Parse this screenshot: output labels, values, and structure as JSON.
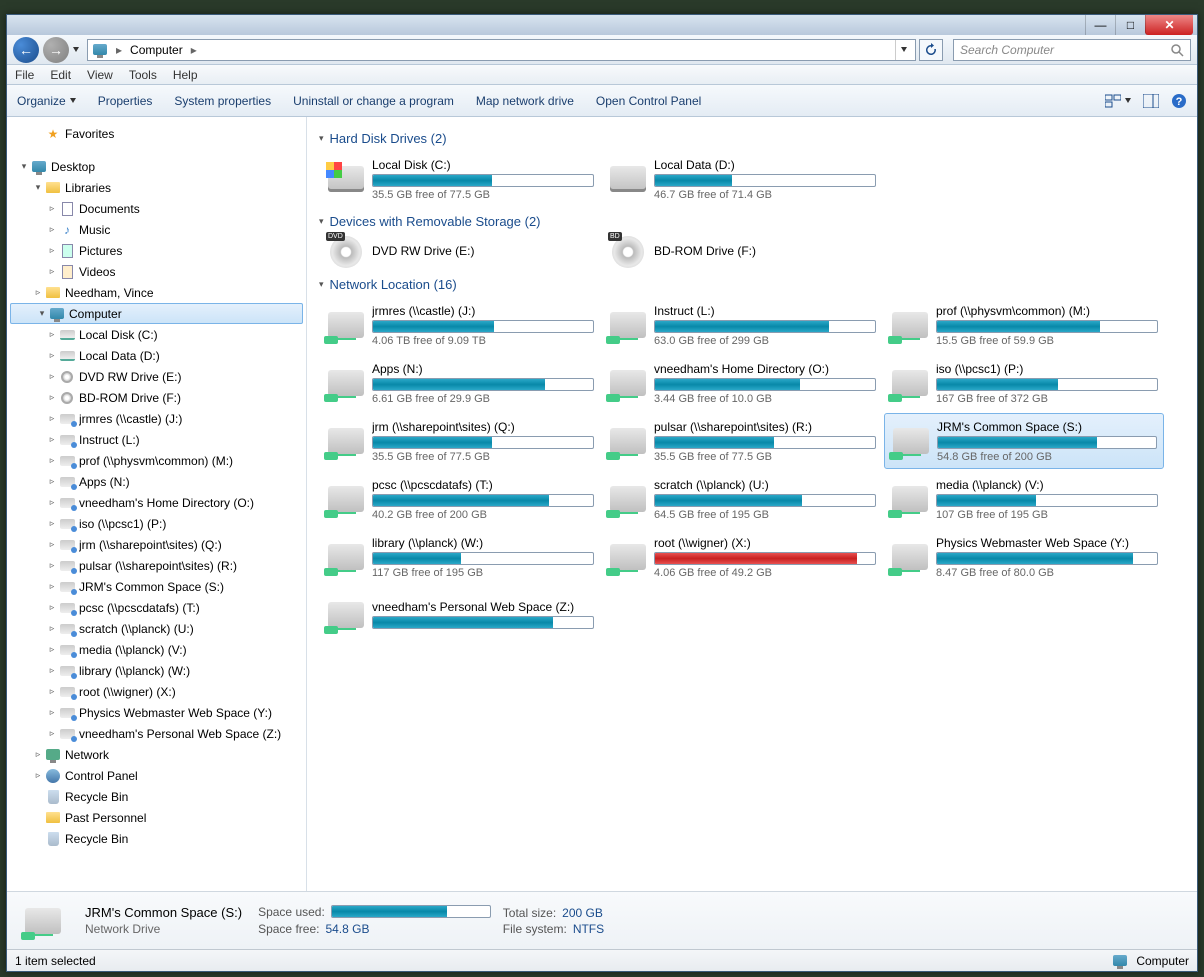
{
  "titlebar": {
    "min": "—",
    "max": "□",
    "close": "✕"
  },
  "nav": {
    "back": "←",
    "fwd": "→"
  },
  "breadcrumb": {
    "root_icon": "computer",
    "seg1": "Computer"
  },
  "search": {
    "placeholder": "Search Computer"
  },
  "menu": {
    "file": "File",
    "edit": "Edit",
    "view": "View",
    "tools": "Tools",
    "help": "Help"
  },
  "toolbar": {
    "organize": "Organize",
    "properties": "Properties",
    "sysprops": "System properties",
    "uninstall": "Uninstall or change a program",
    "mapnet": "Map network drive",
    "cpl": "Open Control Panel"
  },
  "tree": {
    "favorites": "Favorites",
    "desktop": "Desktop",
    "libraries": "Libraries",
    "documents": "Documents",
    "music": "Music",
    "pictures": "Pictures",
    "videos": "Videos",
    "user": "Needham, Vince",
    "computer": "Computer",
    "network": "Network",
    "cpl": "Control Panel",
    "recycle": "Recycle Bin",
    "past": "Past Personnel",
    "recycle2": "Recycle Bin",
    "drives": {
      "c": "Local Disk (C:)",
      "d": "Local Data (D:)",
      "e": "DVD RW Drive (E:)",
      "f": "BD-ROM Drive (F:)",
      "j": "jrmres (\\\\castle) (J:)",
      "l": "Instruct (L:)",
      "m": "prof (\\\\physvm\\common) (M:)",
      "n": "Apps (N:)",
      "o": "vneedham's  Home Directory (O:)",
      "p": "iso (\\\\pcsc1) (P:)",
      "q": "jrm (\\\\sharepoint\\sites) (Q:)",
      "r": "pulsar (\\\\sharepoint\\sites) (R:)",
      "s": "JRM's Common Space (S:)",
      "t": "pcsc (\\\\pcscdatafs) (T:)",
      "u": "scratch (\\\\planck) (U:)",
      "v": "media (\\\\planck) (V:)",
      "w": "library (\\\\planck) (W:)",
      "x": "root (\\\\wigner) (X:)",
      "y": "Physics Webmaster Web Space (Y:)",
      "z": "vneedham's  Personal Web Space (Z:)"
    }
  },
  "sections": {
    "hdd": "Hard Disk Drives (2)",
    "removable": "Devices with Removable Storage (2)",
    "network": "Network Location (16)"
  },
  "drives": {
    "c": {
      "name": "Local Disk (C:)",
      "free": "35.5 GB free of 77.5 GB",
      "pct": 54,
      "type": "win"
    },
    "d": {
      "name": "Local Data (D:)",
      "free": "46.7 GB free of 71.4 GB",
      "pct": 35,
      "type": "hdd"
    },
    "e": {
      "name": "DVD RW Drive (E:)",
      "badge": "DVD"
    },
    "f": {
      "name": "BD-ROM Drive (F:)",
      "badge": "BD"
    },
    "j": {
      "name": "jrmres (\\\\castle) (J:)",
      "free": "4.06 TB free of 9.09 TB",
      "pct": 55
    },
    "l": {
      "name": "Instruct (L:)",
      "free": "63.0 GB free of 299 GB",
      "pct": 79
    },
    "m": {
      "name": "prof (\\\\physvm\\common) (M:)",
      "free": "15.5 GB free of 59.9 GB",
      "pct": 74
    },
    "n": {
      "name": "Apps (N:)",
      "free": "6.61 GB free of 29.9 GB",
      "pct": 78
    },
    "o": {
      "name": "vneedham's  Home Directory (O:)",
      "free": "3.44 GB free of 10.0 GB",
      "pct": 66
    },
    "p": {
      "name": "iso (\\\\pcsc1) (P:)",
      "free": "167 GB free of 372 GB",
      "pct": 55
    },
    "q": {
      "name": "jrm (\\\\sharepoint\\sites) (Q:)",
      "free": "35.5 GB free of 77.5 GB",
      "pct": 54
    },
    "r": {
      "name": "pulsar (\\\\sharepoint\\sites) (R:)",
      "free": "35.5 GB free of 77.5 GB",
      "pct": 54
    },
    "s": {
      "name": "JRM's Common Space (S:)",
      "free": "54.8 GB free of 200 GB",
      "pct": 73
    },
    "t": {
      "name": "pcsc (\\\\pcscdatafs) (T:)",
      "free": "40.2 GB free of 200 GB",
      "pct": 80
    },
    "u": {
      "name": "scratch (\\\\planck) (U:)",
      "free": "64.5 GB free of 195 GB",
      "pct": 67
    },
    "v": {
      "name": "media (\\\\planck) (V:)",
      "free": "107 GB free of 195 GB",
      "pct": 45
    },
    "w": {
      "name": "library (\\\\planck) (W:)",
      "free": "117 GB free of 195 GB",
      "pct": 40
    },
    "x": {
      "name": "root (\\\\wigner) (X:)",
      "free": "4.06 GB free of 49.2 GB",
      "pct": 92,
      "red": true
    },
    "y": {
      "name": "Physics Webmaster Web Space (Y:)",
      "free": "8.47 GB free of 80.0 GB",
      "pct": 89
    },
    "z": {
      "name": "vneedham's  Personal Web Space (Z:)",
      "free": "",
      "pct": 82
    }
  },
  "details": {
    "title": "JRM's Common Space (S:)",
    "subtitle": "Network Drive",
    "used_label": "Space used:",
    "free_label": "Space free:",
    "free_val": "54.8 GB",
    "total_label": "Total size:",
    "total_val": "200 GB",
    "fs_label": "File system:",
    "fs_val": "NTFS"
  },
  "status": {
    "left": "1 item selected",
    "right": "Computer"
  }
}
